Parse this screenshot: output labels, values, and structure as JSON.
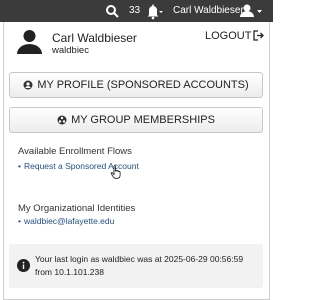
{
  "topbar": {
    "notification_count": "33",
    "username": "Carl Waldbieser",
    "icons": {
      "search": "search-icon",
      "notifications": "bell-icon",
      "user_menu": "user-icon"
    }
  },
  "profile": {
    "name": "Carl Waldbieser",
    "id": "waldbiec",
    "logout_label": "LOGOUT"
  },
  "buttons": {
    "my_profile": "MY PROFILE (SPONSORED ACCOUNTS)",
    "my_groups": "MY GROUP MEMBERSHIPS"
  },
  "enrollment": {
    "title": "Available Enrollment Flows",
    "items": [
      "Request a Sponsored Account"
    ]
  },
  "identities": {
    "title": "My Organizational Identities",
    "items": [
      "waldbiec@lafayette.edu"
    ]
  },
  "last_login": {
    "message": "Your last login as waldbiec was at 2025-06-29 00:56:59 from 10.1.101.238"
  },
  "colors": {
    "topbar_bg": "#3b3b3b",
    "link": "#1e4f8f",
    "info_bg": "#f2f2f2"
  }
}
